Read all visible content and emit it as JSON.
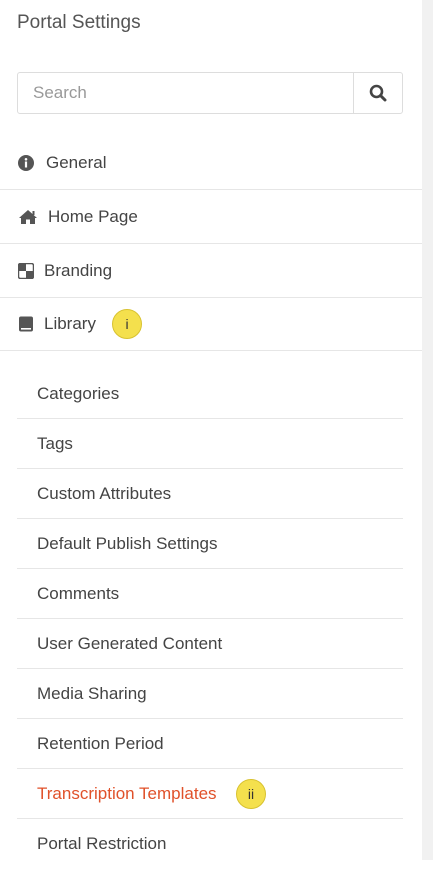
{
  "header": {
    "title": "Portal Settings"
  },
  "search": {
    "placeholder": "Search"
  },
  "nav": {
    "general": "General",
    "home_page": "Home Page",
    "branding": "Branding",
    "library": "Library",
    "library_badge": "i"
  },
  "library_sub": {
    "items": [
      "Categories",
      "Tags",
      "Custom Attributes",
      "Default Publish Settings",
      "Comments",
      "User Generated Content",
      "Media Sharing",
      "Retention Period",
      "Transcription Templates",
      "Portal Restriction"
    ],
    "active_badge": "ii"
  },
  "colors": {
    "active_link": "#e0512a",
    "badge": "#f4e04d"
  }
}
